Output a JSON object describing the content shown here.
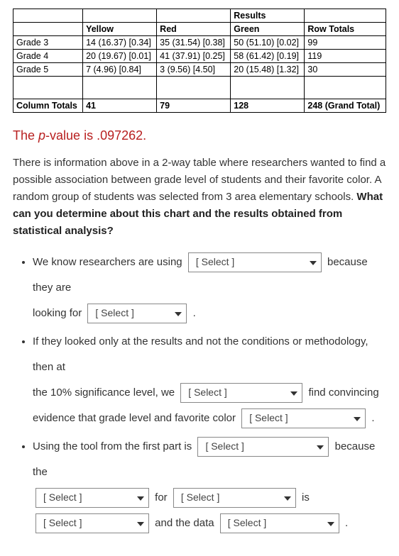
{
  "table": {
    "results_label": "Results",
    "col_headers": [
      "",
      "Yellow",
      "Red",
      "Green",
      "Row Totals"
    ],
    "rows": [
      {
        "label": "Grade 3",
        "cells": [
          "14 (16.37) [0.34]",
          "35 (31.54) [0.38]",
          "50 (51.10) [0.02]",
          "99"
        ]
      },
      {
        "label": "Grade 4",
        "cells": [
          "20 (19.67) [0.01]",
          "41 (37.91) [0.25]",
          "58 (61.42) [0.19]",
          "119"
        ]
      },
      {
        "label": "Grade 5",
        "cells": [
          "7 (4.96) [0.84]",
          "3 (9.56) [4.50]",
          "20 (15.48) [1.32]",
          "30"
        ]
      }
    ],
    "totals": {
      "label": "Column Totals",
      "cells": [
        "41",
        "79",
        "128",
        "248 (Grand Total)"
      ]
    }
  },
  "pvalue_prefix": "The ",
  "pvalue_letter": "p",
  "pvalue_rest": "-value is .097262.",
  "intro_plain": "There is information above in a 2-way table where researchers wanted to find a possible association between grade level of students and their favorite color. A random group of students was selected from 3 area elementary schools. ",
  "intro_bold": "What can you determine about this chart and the results obtained from statistical analysis?",
  "q": {
    "b1_a": "We know researchers are using",
    "b1_b": "because they are",
    "b1_c": "looking for",
    "b2_a": "If they looked only at the results and not the conditions or methodology, then at",
    "b2_b": "the 10% significance level, we",
    "b2_c": "find convincing",
    "b2_d": "evidence that grade level and favorite color",
    "b3_a": "Using the tool from the first part is",
    "b3_b": "because the",
    "b3_c": "for",
    "b3_d": "is",
    "b3_e": "and the data"
  },
  "select_placeholder": "[ Select ]",
  "dot": ".",
  "chart_data": {
    "type": "table",
    "title": "Results",
    "row_categories": [
      "Grade 3",
      "Grade 4",
      "Grade 5"
    ],
    "col_categories": [
      "Yellow",
      "Red",
      "Green"
    ],
    "observed": [
      [
        14,
        35,
        50
      ],
      [
        20,
        41,
        58
      ],
      [
        7,
        3,
        20
      ]
    ],
    "expected": [
      [
        16.37,
        31.54,
        51.1
      ],
      [
        19.67,
        37.91,
        61.42
      ],
      [
        4.96,
        9.56,
        15.48
      ]
    ],
    "chi_sq_contribution": [
      [
        0.34,
        0.38,
        0.02
      ],
      [
        0.01,
        0.25,
        0.19
      ],
      [
        0.84,
        4.5,
        1.32
      ]
    ],
    "row_totals": [
      99,
      119,
      30
    ],
    "column_totals": [
      41,
      79,
      128
    ],
    "grand_total": 248,
    "p_value": 0.097262
  }
}
